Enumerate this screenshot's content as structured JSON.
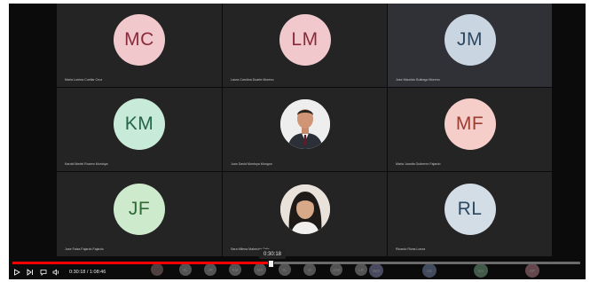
{
  "tiles": [
    {
      "initials": "MC",
      "name": "Maria Lorena Cuellar Cruz",
      "bg": "#f1c9cd",
      "fg": "#8a2b3a",
      "photo": false,
      "active": false
    },
    {
      "initials": "LM",
      "name": "Laura Carolina Duarte Moreno",
      "bg": "#f1c9cd",
      "fg": "#8a2b3a",
      "photo": false,
      "active": false
    },
    {
      "initials": "JM",
      "name": "Jose Mauricio Buitrago Moreno",
      "bg": "#c9d6e2",
      "fg": "#2e4860",
      "photo": false,
      "active": true
    },
    {
      "initials": "KM",
      "name": "Karold Medel Rosero Montoya",
      "bg": "#c8ead9",
      "fg": "#236548",
      "photo": false,
      "active": false
    },
    {
      "initials": "",
      "name": "Juan David Montoya Mongon",
      "photo": true,
      "photo_kind": "man",
      "active": false
    },
    {
      "initials": "MF",
      "name": "Maria Juanita Gutierrez Fajardo",
      "bg": "#f5cec9",
      "fg": "#9a3d32",
      "photo": false,
      "active": false
    },
    {
      "initials": "JF",
      "name": "Jose Faiza Fajardo Fajardo",
      "bg": "#cdeacd",
      "fg": "#2d6a35",
      "photo": false,
      "active": false
    },
    {
      "initials": "",
      "name": "Sara Milena Mahecha Ortiz",
      "photo": true,
      "photo_kind": "woman",
      "active": false
    },
    {
      "initials": "RL",
      "name": "Ricardo Rivas Loeza",
      "bg": "#d3dde6",
      "fg": "#2d4a62",
      "photo": false,
      "active": false
    }
  ],
  "player": {
    "tooltip_time": "0:30:18",
    "current_time": "0:30:18",
    "separator": "/",
    "total_time": "1:08:46",
    "progress_fraction": 0.455,
    "play_icon": "play-icon",
    "next_icon": "next-icon",
    "volume_icon": "volume-icon"
  },
  "strip_chips": [
    {
      "text": "",
      "color": "#8a6b6b"
    },
    {
      "text": "SL",
      "color": "#8e8e8e"
    },
    {
      "text": "JR",
      "color": "#8e8e8e"
    },
    {
      "text": "KM",
      "color": "#8e8e8e"
    },
    {
      "text": "MS",
      "color": "#8e8e8e"
    },
    {
      "text": "SL",
      "color": "#8e8e8e"
    },
    {
      "text": "IO",
      "color": "#8e8e8e"
    },
    {
      "text": "JJM",
      "color": "#8e8e8e"
    },
    {
      "text": "LR",
      "color": "#8e8e8e"
    },
    {
      "text": "WO",
      "color": "#7d7fa6"
    },
    {
      "text": "CE",
      "color": "#6f7fa3"
    },
    {
      "text": "EA",
      "color": "#6e9c7e"
    },
    {
      "text": "AP",
      "color": "#b07a86"
    }
  ]
}
